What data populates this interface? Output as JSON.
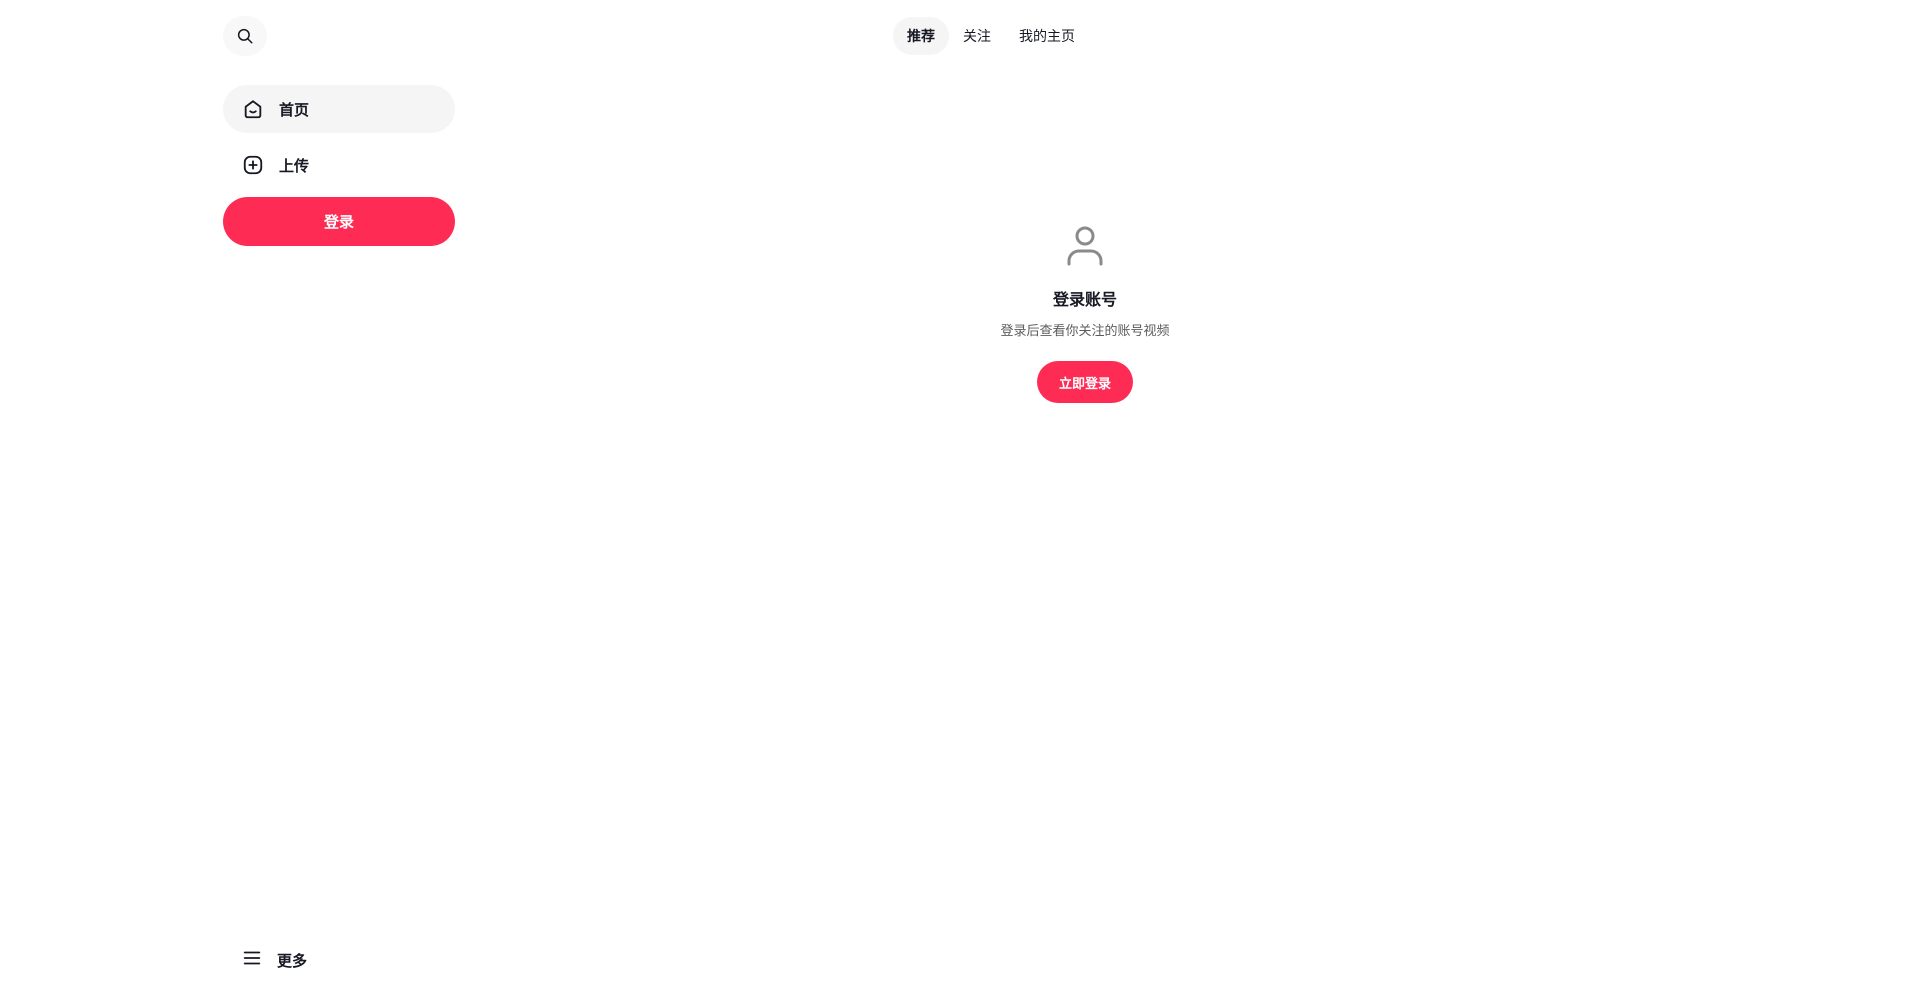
{
  "sidebar": {
    "search_icon": "search-icon",
    "items": [
      {
        "label": "首页",
        "icon": "home-icon",
        "active": true
      },
      {
        "label": "上传",
        "icon": "plus-square-icon",
        "active": false
      }
    ],
    "login_label": "登录",
    "more": {
      "label": "更多",
      "icon": "menu-icon"
    }
  },
  "tabs": [
    {
      "label": "推荐",
      "active": true
    },
    {
      "label": "关注"
    },
    {
      "label": "我的主页"
    }
  ],
  "empty_state": {
    "icon": "user-icon",
    "title": "登录账号",
    "subtitle": "登录后查看你关注的账号视频",
    "button_label": "立即登录"
  },
  "colors": {
    "accent": "#fe2c55",
    "text": "#161823",
    "muted_bg": "#f5f5f5"
  }
}
